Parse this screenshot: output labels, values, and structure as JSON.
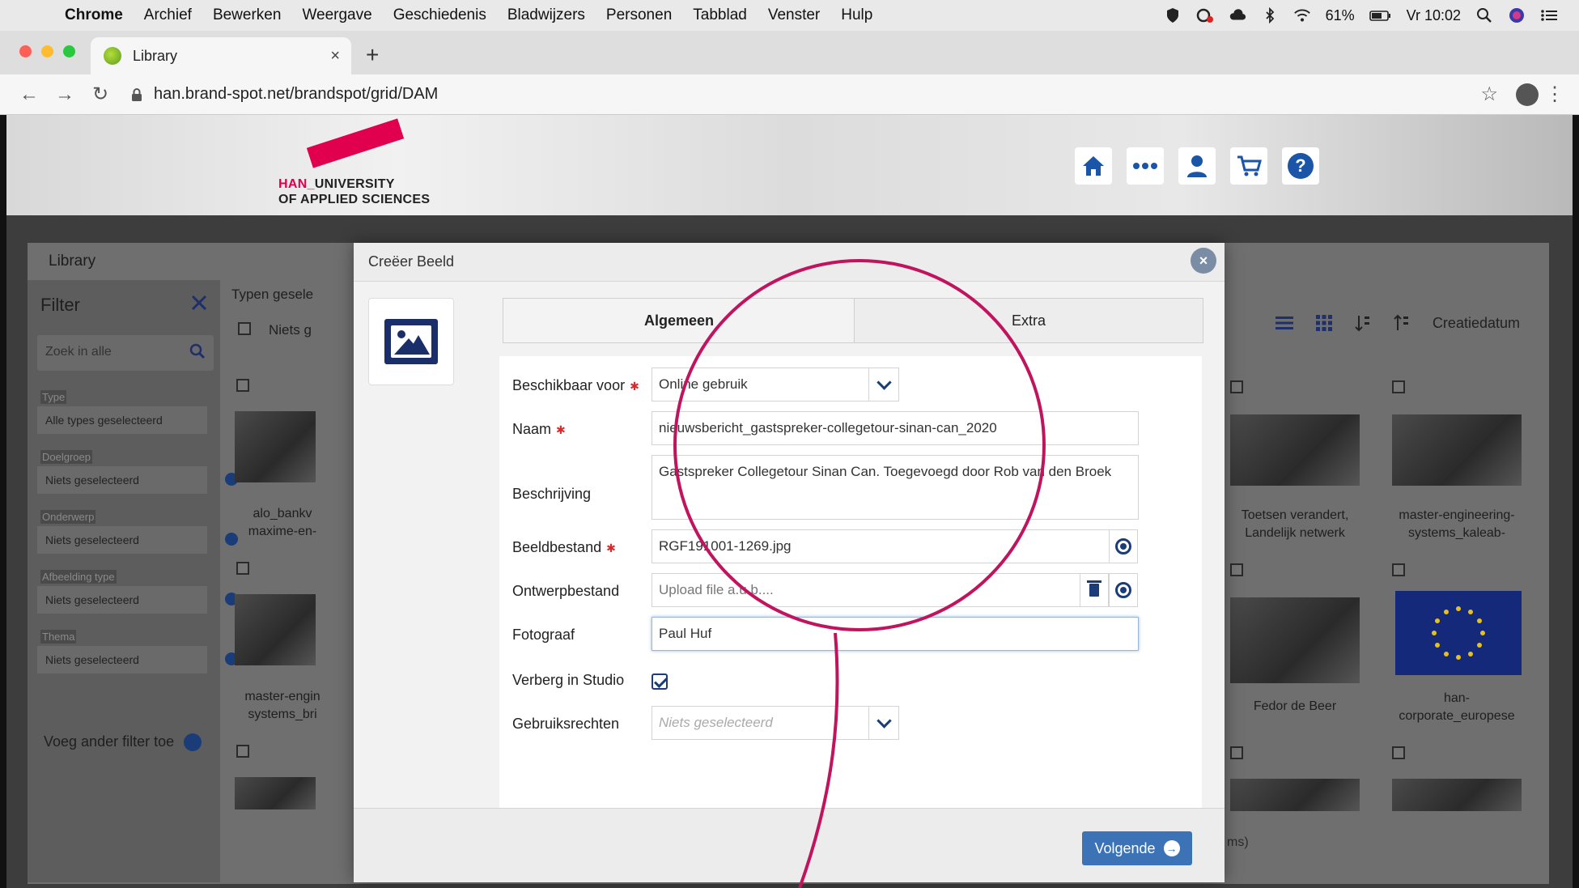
{
  "menubar": {
    "app": "Chrome",
    "items": [
      "Archief",
      "Bewerken",
      "Weergave",
      "Geschiedenis",
      "Bladwijzers",
      "Personen",
      "Tabblad",
      "Venster",
      "Hulp"
    ],
    "battery": "61%",
    "clock": "Vr 10:02"
  },
  "browser": {
    "tab_title": "Library",
    "tab_close": "×",
    "new_tab": "+",
    "url": "han.brand-spot.net/brandspot/grid/DAM"
  },
  "site": {
    "logo_line1_han": "HAN_",
    "logo_line1_rest": "UNIVERSITY",
    "logo_line2": "OF APPLIED SCIENCES"
  },
  "library": {
    "title": "Library",
    "filter_title": "Filter",
    "search_placeholder": "Zoek in alle",
    "groups": [
      {
        "label": "Type",
        "value": "Alle types geselecteerd"
      },
      {
        "label": "Doelgroep",
        "value": "Niets geselecteerd"
      },
      {
        "label": "Onderwerp",
        "value": "Niets geselecteerd"
      },
      {
        "label": "Afbeelding type",
        "value": "Niets geselecteerd"
      },
      {
        "label": "Thema",
        "value": "Niets geselecteerd"
      }
    ],
    "add_filter": "Voeg ander filter toe",
    "types_label": "Typen gesele",
    "niets_label": "Niets g",
    "sort_label": "Creatiedatum",
    "captions": {
      "c1": "alo_bankv\nmaxime-en-",
      "c2": "master-engin\nsystems_bri",
      "c3": "Toetsen verandert,\nLandelijk netwerk",
      "c4": "master-engineering-\nsystems_kaleab-",
      "c5": "Fedor de Beer",
      "c6": "han-\ncorporate_europese"
    },
    "items_suffix": "ms)"
  },
  "modal": {
    "title": "Creëer Beeld",
    "close": "×",
    "tab_general": "Algemeen",
    "tab_extra": "Extra",
    "fields": {
      "available_label": "Beschikbaar voor",
      "available_value": "Online gebruik",
      "name_label": "Naam",
      "name_value": "nieuwsbericht_gastspreker-collegetour-sinan-can_2020",
      "desc_label": "Beschrijving",
      "desc_value": "Gastspreker Collegetour Sinan Can. Toegevoegd door Rob van den Broek",
      "image_label": "Beeldbestand",
      "image_value": "RGF191001-1269.jpg",
      "design_label": "Ontwerpbestand",
      "design_placeholder": "Upload file a.u.b....",
      "photographer_label": "Fotograaf",
      "photographer_value": "Paul Huf",
      "hide_label": "Verberg in Studio",
      "rights_label": "Gebruiksrechten",
      "rights_placeholder": "Niets geselecteerd"
    },
    "required_mark": "✱",
    "next_button": "Volgende"
  },
  "colors": {
    "accent_blue": "#1a3d7a",
    "button_blue": "#3b73b6",
    "annotation": "#c0145e",
    "han_red": "#e0004d"
  }
}
